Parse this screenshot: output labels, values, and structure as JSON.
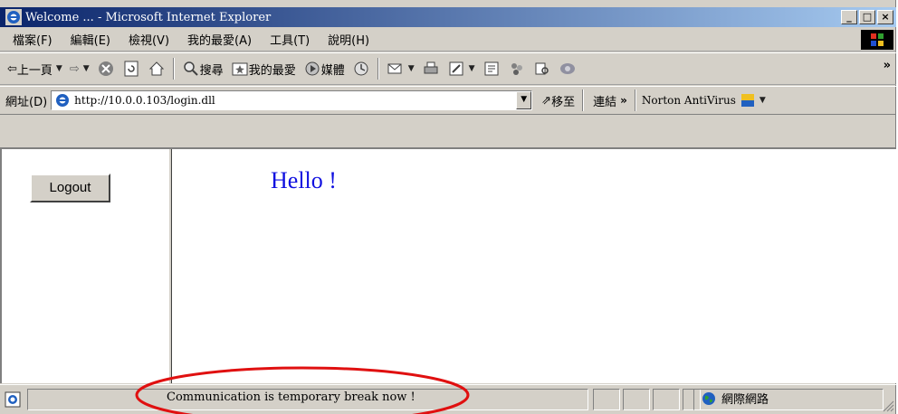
{
  "window": {
    "title": "Welcome ... - Microsoft Internet Explorer",
    "controls": [
      "_",
      "□",
      "×"
    ]
  },
  "menu": {
    "items": [
      "檔案(F)",
      "編輯(E)",
      "檢視(V)",
      "我的最愛(A)",
      "工具(T)",
      "說明(H)"
    ]
  },
  "toolbar": {
    "back_label": "上一頁",
    "search_label": "搜尋",
    "favorites_label": "我的最愛",
    "media_label": "媒體",
    "overflow": "»"
  },
  "address": {
    "label": "網址(D)",
    "url": "http://10.0.0.103/login.dll",
    "go_label": "移至",
    "links_label": "連結",
    "links_chevron": "»",
    "norton_label": "Norton AntiVirus"
  },
  "page": {
    "logout_label": "Logout",
    "greeting": "Hello !"
  },
  "status": {
    "message": "Communication is temporary break now !",
    "zone": "網際網路"
  },
  "colors": {
    "title_gradient_start": "#0a246a",
    "title_gradient_end": "#a6caf0",
    "greeting": "#1010e0",
    "annotation": "#e01010"
  }
}
